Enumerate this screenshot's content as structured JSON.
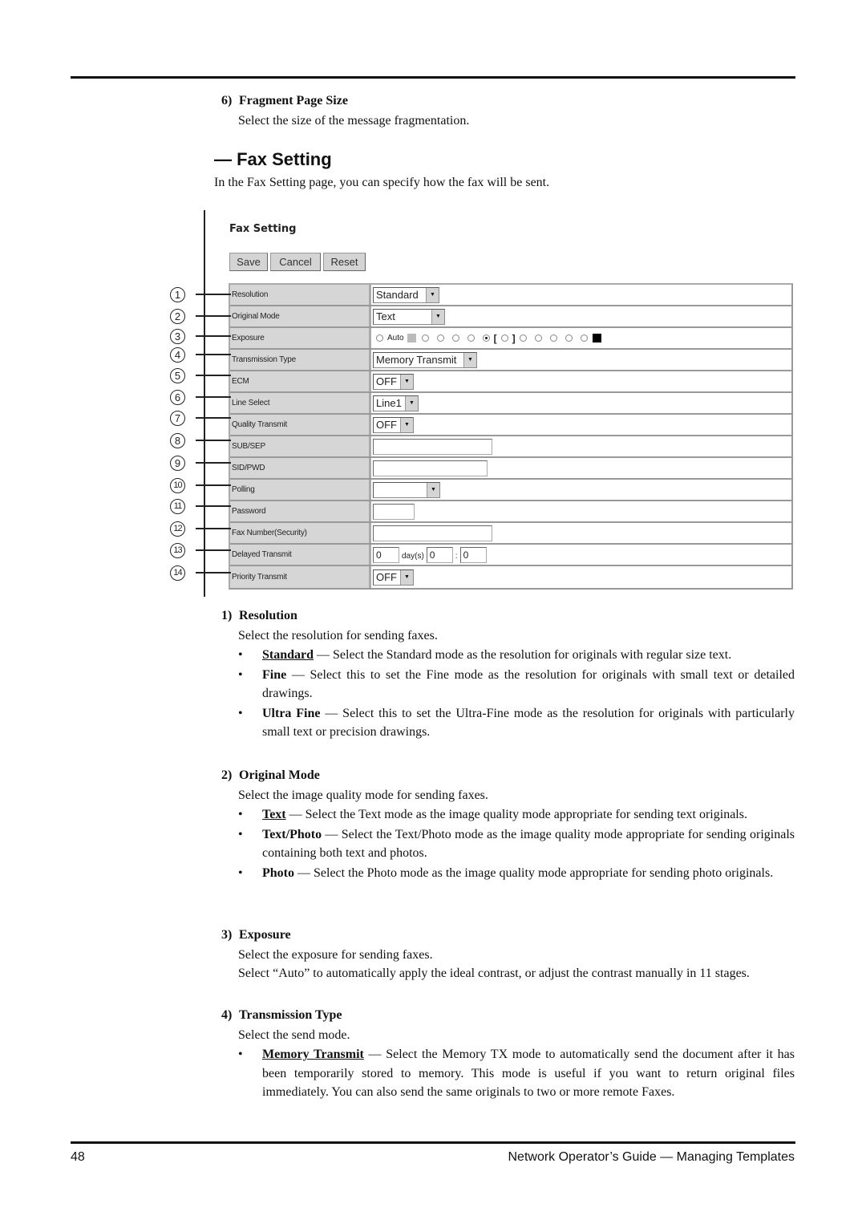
{
  "fragment_section": {
    "number": "6)",
    "title": "Fragment Page Size",
    "description": "Select the size of the message fragmentation."
  },
  "fax_setting_heading": "— Fax Setting",
  "intro": "In the Fax Setting page, you can specify how the fax will be sent.",
  "screenshot": {
    "title": "Fax Setting",
    "buttons": {
      "save": "Save",
      "cancel": "Cancel",
      "reset": "Reset"
    },
    "callouts": [
      "1",
      "2",
      "3",
      "4",
      "5",
      "6",
      "7",
      "8",
      "9",
      "10",
      "11",
      "12",
      "13",
      "14"
    ],
    "rows": [
      {
        "label": "Resolution",
        "type": "select",
        "value": "Standard"
      },
      {
        "label": "Original Mode",
        "type": "select",
        "value": "Text"
      },
      {
        "label": "Exposure",
        "type": "radio",
        "auto_label": "Auto",
        "selected_index": 5,
        "levels": 11
      },
      {
        "label": "Transmission Type",
        "type": "select",
        "value": "Memory Transmit"
      },
      {
        "label": "ECM",
        "type": "select",
        "value": "OFF"
      },
      {
        "label": "Line Select",
        "type": "select",
        "value": "Line1"
      },
      {
        "label": "Quality Transmit",
        "type": "select",
        "value": "OFF"
      },
      {
        "label": "SUB/SEP",
        "type": "input",
        "value": ""
      },
      {
        "label": "SID/PWD",
        "type": "input",
        "value": ""
      },
      {
        "label": "Polling",
        "type": "select",
        "value": ""
      },
      {
        "label": "Password",
        "type": "input",
        "value": ""
      },
      {
        "label": "Fax Number(Security)",
        "type": "input",
        "value": ""
      },
      {
        "label": "Delayed Transmit",
        "type": "delay",
        "days": "0",
        "days_label": "day(s)",
        "hours": "0",
        "sep": ":",
        "minutes": "0"
      },
      {
        "label": "Priority Transmit",
        "type": "select",
        "value": "OFF"
      }
    ]
  },
  "sections": {
    "resolution": {
      "number": "1)",
      "title": "Resolution",
      "description": "Select the resolution for sending faxes.",
      "bullets": [
        {
          "term": "Standard",
          "text": " — Select the Standard mode as the resolution for originals with regular size text."
        },
        {
          "term": "Fine",
          "text": " — Select this to set the Fine mode as the resolution for originals with small text or detailed drawings."
        },
        {
          "term": "Ultra Fine",
          "text": " — Select this to set the Ultra-Fine mode as the resolution for originals with particularly small text or precision drawings."
        }
      ]
    },
    "original_mode": {
      "number": "2)",
      "title": "Original Mode",
      "description": "Select the image quality mode for sending faxes.",
      "bullets": [
        {
          "term": "Text",
          "text": " — Select the Text mode as the image quality mode appropriate for sending text originals."
        },
        {
          "term": "Text/Photo",
          "text": " — Select the Text/Photo mode as the image quality mode appropriate for sending originals containing both text and photos."
        },
        {
          "term": "Photo",
          "text": " — Select the Photo mode as the image quality mode appropriate for sending photo originals."
        }
      ]
    },
    "exposure": {
      "number": "3)",
      "title": "Exposure",
      "description": "Select the exposure for sending faxes.",
      "description2": "Select “Auto” to automatically apply the ideal contrast, or adjust the contrast manually in 11 stages."
    },
    "transmission_type": {
      "number": "4)",
      "title": "Transmission Type",
      "description": "Select the send mode.",
      "bullets": [
        {
          "term": "Memory Transmit",
          "text": " — Select the Memory TX mode to automatically send the document after it has been temporarily stored to memory.  This mode is useful if you want to return original files immediately.  You can also send the same originals to two or more remote Faxes."
        }
      ]
    }
  },
  "footer": {
    "page_number": "48",
    "title": "Network Operator’s Guide — Managing Templates"
  }
}
